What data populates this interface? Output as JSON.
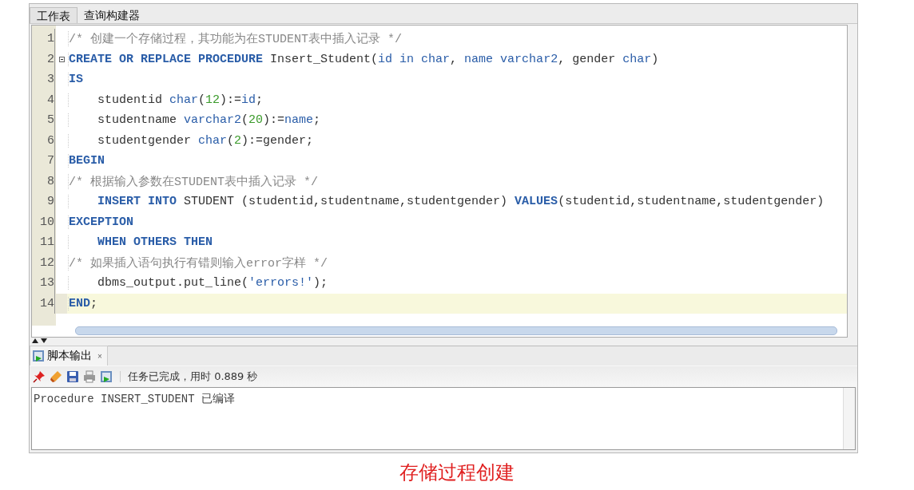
{
  "editor_tabs": [
    {
      "label": "工作表",
      "selected": true
    },
    {
      "label": "查询构建器",
      "selected": false
    }
  ],
  "code_lines": [
    {
      "number": "1",
      "indented": false,
      "fold_marker": false,
      "current": false,
      "tokens": [
        {
          "kind": "comment",
          "text": "/* 创建一个存储过程，其功能为在STUDENT表中插入记录 */"
        }
      ]
    },
    {
      "number": "2",
      "indented": false,
      "fold_marker": true,
      "current": false,
      "tokens": [
        {
          "kind": "keyword",
          "text": "CREATE OR REPLACE PROCEDURE"
        },
        {
          "kind": "plain",
          "text": " Insert_Student("
        },
        {
          "kind": "type",
          "text": "id in char"
        },
        {
          "kind": "plain",
          "text": ", "
        },
        {
          "kind": "type",
          "text": "name varchar2"
        },
        {
          "kind": "plain",
          "text": ", gender "
        },
        {
          "kind": "type",
          "text": "char"
        },
        {
          "kind": "plain",
          "text": ")"
        }
      ]
    },
    {
      "number": "3",
      "indented": false,
      "fold_marker": false,
      "current": false,
      "tokens": [
        {
          "kind": "keyword",
          "text": "IS"
        }
      ]
    },
    {
      "number": "4",
      "indented": true,
      "fold_marker": false,
      "current": false,
      "tokens": [
        {
          "kind": "plain",
          "text": "studentid "
        },
        {
          "kind": "type",
          "text": "char"
        },
        {
          "kind": "plain",
          "text": "("
        },
        {
          "kind": "number",
          "text": "12"
        },
        {
          "kind": "plain",
          "text": "):="
        },
        {
          "kind": "type",
          "text": "id"
        },
        {
          "kind": "plain",
          "text": ";"
        }
      ]
    },
    {
      "number": "5",
      "indented": true,
      "fold_marker": false,
      "current": false,
      "tokens": [
        {
          "kind": "plain",
          "text": "studentname "
        },
        {
          "kind": "type",
          "text": "varchar2"
        },
        {
          "kind": "plain",
          "text": "("
        },
        {
          "kind": "number",
          "text": "20"
        },
        {
          "kind": "plain",
          "text": "):="
        },
        {
          "kind": "type",
          "text": "name"
        },
        {
          "kind": "plain",
          "text": ";"
        }
      ]
    },
    {
      "number": "6",
      "indented": true,
      "fold_marker": false,
      "current": false,
      "tokens": [
        {
          "kind": "plain",
          "text": "studentgender "
        },
        {
          "kind": "type",
          "text": "char"
        },
        {
          "kind": "plain",
          "text": "("
        },
        {
          "kind": "number",
          "text": "2"
        },
        {
          "kind": "plain",
          "text": "):=gender;"
        }
      ]
    },
    {
      "number": "7",
      "indented": false,
      "fold_marker": false,
      "current": false,
      "tokens": [
        {
          "kind": "keyword",
          "text": "BEGIN"
        }
      ]
    },
    {
      "number": "8",
      "indented": false,
      "fold_marker": false,
      "current": false,
      "tokens": [
        {
          "kind": "comment",
          "text": "/* 根据输入参数在STUDENT表中插入记录 */"
        }
      ]
    },
    {
      "number": "9",
      "indented": true,
      "fold_marker": false,
      "current": false,
      "tokens": [
        {
          "kind": "keyword",
          "text": "INSERT INTO"
        },
        {
          "kind": "plain",
          "text": " STUDENT (studentid,studentname,studentgender) "
        },
        {
          "kind": "keyword",
          "text": "VALUES"
        },
        {
          "kind": "plain",
          "text": "(studentid,studentname,studentgender)"
        }
      ]
    },
    {
      "number": "10",
      "indented": false,
      "fold_marker": false,
      "current": false,
      "tokens": [
        {
          "kind": "keyword",
          "text": "EXCEPTION"
        }
      ]
    },
    {
      "number": "11",
      "indented": true,
      "fold_marker": false,
      "current": false,
      "tokens": [
        {
          "kind": "keyword",
          "text": "WHEN OTHERS THEN"
        }
      ]
    },
    {
      "number": "12",
      "indented": false,
      "fold_marker": false,
      "current": false,
      "tokens": [
        {
          "kind": "comment",
          "text": "/* 如果插入语句执行有错则输入error字样 */"
        }
      ]
    },
    {
      "number": "13",
      "indented": true,
      "fold_marker": false,
      "current": false,
      "tokens": [
        {
          "kind": "plain",
          "text": "dbms_output.put_line("
        },
        {
          "kind": "string",
          "text": "'errors!'"
        },
        {
          "kind": "plain",
          "text": ");"
        }
      ]
    },
    {
      "number": "14",
      "indented": false,
      "fold_marker": false,
      "current": true,
      "tokens": [
        {
          "kind": "keyword",
          "text": "END"
        },
        {
          "kind": "plain",
          "text": ";"
        }
      ]
    }
  ],
  "output_panel": {
    "tab": {
      "label": "脚本输出",
      "close": "×"
    },
    "toolbar_icons": [
      {
        "kind": "pin"
      },
      {
        "kind": "eraser"
      },
      {
        "kind": "save"
      },
      {
        "kind": "print"
      },
      {
        "kind": "run"
      }
    ],
    "status": "任务已完成，用时 0.889 秒",
    "output_text": "Procedure INSERT_STUDENT 已编译"
  },
  "caption": "存储过程创建"
}
